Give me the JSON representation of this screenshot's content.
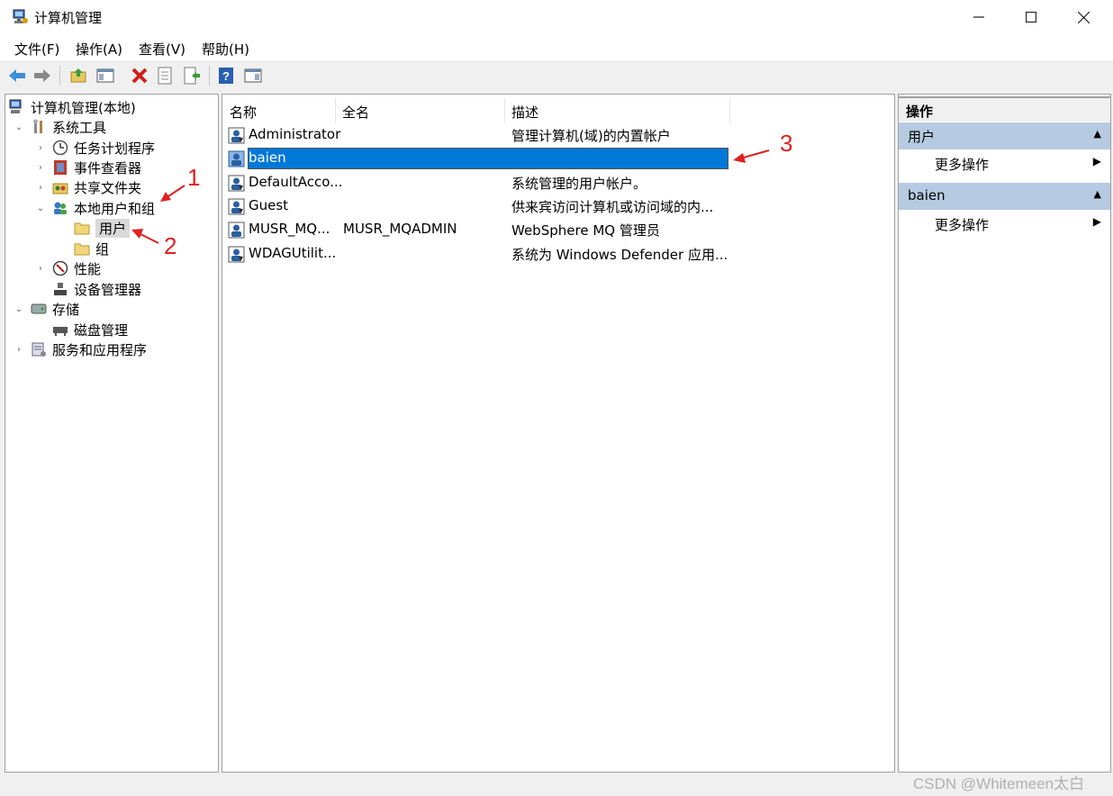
{
  "window": {
    "title": "计算机管理"
  },
  "menubar": {
    "items": [
      "文件(F)",
      "操作(A)",
      "查看(V)",
      "帮助(H)"
    ]
  },
  "toolbar": {
    "buttons": [
      "back-icon",
      "forward-icon",
      "up-folder-icon",
      "show-hide-tree-icon",
      "delete-icon",
      "properties-icon",
      "export-list-icon",
      "help-icon",
      "show-action-pane-icon"
    ]
  },
  "tree": {
    "root": "计算机管理(本地)",
    "system_tools": "系统工具",
    "task_scheduler": "任务计划程序",
    "event_viewer": "事件查看器",
    "shared_folders": "共享文件夹",
    "local_users_groups": "本地用户和组",
    "users": "用户",
    "groups": "组",
    "performance": "性能",
    "device_manager": "设备管理器",
    "storage": "存储",
    "disk_management": "磁盘管理",
    "services_apps": "服务和应用程序"
  },
  "list": {
    "columns": [
      "名称",
      "全名",
      "描述"
    ],
    "rows": [
      {
        "name": "Administrator",
        "fullname": "",
        "desc": "管理计算机(域)的内置帐户"
      },
      {
        "name": "baien",
        "fullname": "",
        "desc": ""
      },
      {
        "name": "DefaultAcco...",
        "fullname": "",
        "desc": "系统管理的用户帐户。"
      },
      {
        "name": "Guest",
        "fullname": "",
        "desc": "供来宾访问计算机或访问域的内..."
      },
      {
        "name": "MUSR_MQ...",
        "fullname": "MUSR_MQADMIN",
        "desc": "WebSphere MQ 管理员"
      },
      {
        "name": "WDAGUtilit...",
        "fullname": "",
        "desc": "系统为 Windows Defender 应用..."
      }
    ],
    "selected_row": "baien"
  },
  "actions": {
    "header": "操作",
    "group1_title": "用户",
    "group1_item": "更多操作",
    "group2_title": "baien",
    "group2_item": "更多操作"
  },
  "annotations": {
    "a1": "1",
    "a2": "2",
    "a3": "3"
  },
  "watermark": "CSDN @Whitemeen太白",
  "colors": {
    "selection": "#0078d7",
    "action_group": "#b6cbe2",
    "annotation": "#e02020"
  }
}
